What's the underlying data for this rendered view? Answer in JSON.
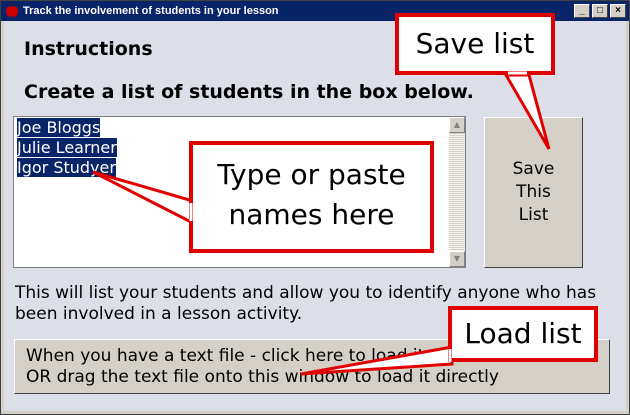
{
  "window": {
    "title": "Track the involvement of students in your lesson",
    "controls": [
      "minimize-icon",
      "maximize-icon",
      "close-icon"
    ],
    "titlebar_color": "#0a246a"
  },
  "main": {
    "instructions_heading": "Instructions",
    "create_heading": "Create a list of students in the box below.",
    "students": [
      "Joe Bloggs",
      "Julie Learner",
      "Igor Studyer"
    ],
    "save_button": [
      "Save",
      "This",
      "List"
    ],
    "info_text": "This will list your students and allow you to identify anyone who has been involved in a lesson activity.",
    "load_button": {
      "line1": "When you have a text file - click here to load it,",
      "line2": "OR drag the text file onto this window to load it directly"
    }
  },
  "callouts": {
    "save_list": "Save list",
    "type_names_line1": "Type or paste",
    "type_names_line2": "names here",
    "load_list": "Load list",
    "border_color": "#e00000"
  }
}
